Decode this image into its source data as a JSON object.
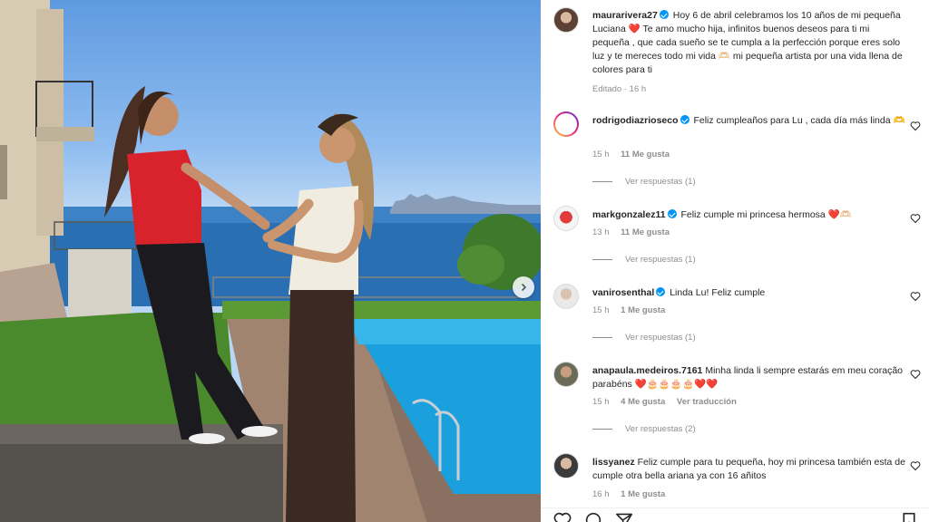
{
  "post": {
    "author": "maurarivera27",
    "caption": "Hoy 6 de abril celebramos los 10 años de mi pequeña Luciana ❤️ Te amo mucho hija, infinitos buenos deseos para ti mi pequeña , que cada sueño se te cumpla a la perfección porque eres solo luz y te mereces todo mi vida 🫶🏻 mi pequeña artista por una vida llena de colores para ti",
    "edited_label": "Editado · 16 h"
  },
  "comments": [
    {
      "user": "rodrigodiazrioseco",
      "verified": true,
      "text": "Feliz cumpleaños para Lu , cada día más linda 🫶",
      "time": "15 h",
      "likes": "11 Me gusta",
      "replies": "Ver respuestas (1)"
    },
    {
      "user": "markgonzalez11",
      "verified": true,
      "text": "Feliz cumple mi princesa hermosa ❤️🫶🏻",
      "time": "13 h",
      "likes": "11 Me gusta",
      "replies": "Ver respuestas (1)"
    },
    {
      "user": "vanirosenthal",
      "verified": true,
      "text": "Linda Lu! Feliz cumple",
      "time": "15 h",
      "likes": "1 Me gusta",
      "replies": "Ver respuestas (1)"
    },
    {
      "user": "anapaula.medeiros.7161",
      "verified": false,
      "text": "Minha linda li sempre estarás em meu coração parabéns ❤️🎂🎂🎂🎂❤️❤️",
      "time": "15 h",
      "likes": "4 Me gusta",
      "translate": "Ver traducción",
      "replies": "Ver respuestas (2)"
    },
    {
      "user": "lissyanez",
      "verified": false,
      "text": "Feliz cumple para tu pequeña, hoy mi princesa también esta de cumple otra bella ariana ya con 16 añitos",
      "time": "16 h",
      "likes": "1 Me gusta"
    }
  ],
  "icons": [
    "verified-badge-icon",
    "heart-icon",
    "comment-icon",
    "share-icon",
    "bookmark-icon",
    "chevron-right-icon"
  ],
  "colors": {
    "verified": "#0095f6",
    "meta": "#8e8e8e",
    "text": "#262626"
  }
}
